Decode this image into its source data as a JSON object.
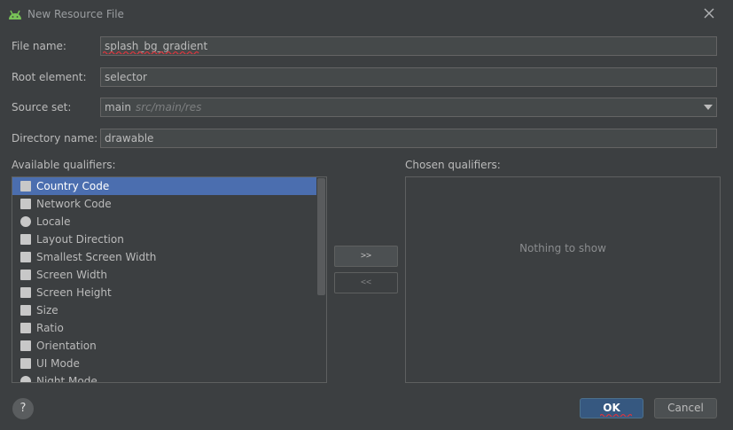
{
  "window": {
    "title": "New Resource File"
  },
  "form": {
    "file_name_label": "File name:",
    "file_name_value": "splash_bg_gradient",
    "root_element_label": "Root element:",
    "root_element_value": "selector",
    "source_set_label": "Source set:",
    "source_set_value": "main",
    "source_set_hint": "src/main/res",
    "directory_name_label": "Directory name:",
    "directory_name_value": "drawable"
  },
  "qualifiers": {
    "available_label": "Available qualifiers:",
    "chosen_label": "Chosen qualifiers:",
    "empty_text": "Nothing to show",
    "add_button": ">>",
    "remove_button": "<<",
    "items": [
      {
        "label": "Country Code",
        "icon": "country-code-icon",
        "selected": true
      },
      {
        "label": "Network Code",
        "icon": "network-code-icon",
        "selected": false
      },
      {
        "label": "Locale",
        "icon": "globe-icon",
        "selected": false
      },
      {
        "label": "Layout Direction",
        "icon": "layout-direction-icon",
        "selected": false
      },
      {
        "label": "Smallest Screen Width",
        "icon": "smallest-width-icon",
        "selected": false
      },
      {
        "label": "Screen Width",
        "icon": "screen-width-icon",
        "selected": false
      },
      {
        "label": "Screen Height",
        "icon": "screen-height-icon",
        "selected": false
      },
      {
        "label": "Size",
        "icon": "size-icon",
        "selected": false
      },
      {
        "label": "Ratio",
        "icon": "ratio-icon",
        "selected": false
      },
      {
        "label": "Orientation",
        "icon": "orientation-icon",
        "selected": false
      },
      {
        "label": "UI Mode",
        "icon": "ui-mode-icon",
        "selected": false
      },
      {
        "label": "Night Mode",
        "icon": "night-mode-icon",
        "selected": false
      }
    ]
  },
  "footer": {
    "help_label": "?",
    "ok_label": "OK",
    "cancel_label": "Cancel"
  },
  "colors": {
    "background": "#3c3f41",
    "selection": "#4b6eaf",
    "primary_button": "#365880",
    "spellcheck_underline": "#d9363e",
    "android_green": "#78c257"
  }
}
